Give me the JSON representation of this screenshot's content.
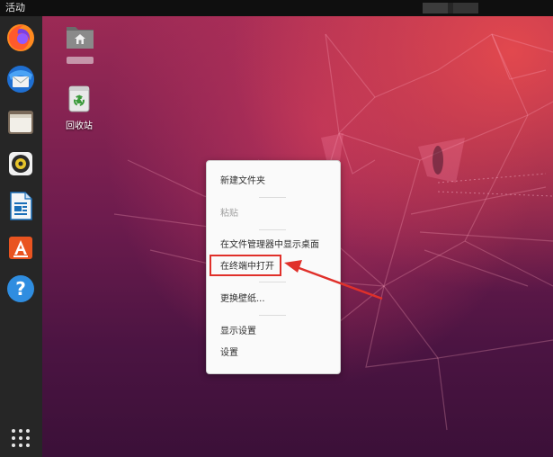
{
  "topbar": {
    "activities_label": "活动"
  },
  "dock": {
    "items": [
      {
        "name": "firefox",
        "icon": "firefox-icon"
      },
      {
        "name": "thunderbird",
        "icon": "thunderbird-mail-icon"
      },
      {
        "name": "files",
        "icon": "files-folder-icon"
      },
      {
        "name": "rhythmbox",
        "icon": "rhythmbox-speaker-icon"
      },
      {
        "name": "libreoffice-writer",
        "icon": "writer-document-icon"
      },
      {
        "name": "ubuntu-software",
        "icon": "software-store-icon"
      },
      {
        "name": "help",
        "icon": "help-question-icon"
      }
    ],
    "show_apps_icon": "app-grid-icon"
  },
  "desktop": {
    "home_folder": {
      "icon": "home-folder-icon"
    },
    "trash": {
      "label": "回收站",
      "icon": "trash-icon"
    }
  },
  "context_menu": {
    "items": [
      {
        "label": "新建文件夹",
        "enabled": true
      },
      {
        "label": "粘贴",
        "enabled": false
      },
      {
        "label": "在文件管理器中显示桌面",
        "enabled": true
      },
      {
        "label": "在终端中打开",
        "enabled": true,
        "highlighted": true
      },
      {
        "label": "更换壁纸...",
        "enabled": true
      },
      {
        "label": "显示设置",
        "enabled": true
      },
      {
        "label": "设置",
        "enabled": true
      }
    ]
  },
  "colors": {
    "annotation": "#e0302a",
    "topbar": "#0f0f0f",
    "dock": "#262626",
    "menu_bg": "#fafafa"
  }
}
